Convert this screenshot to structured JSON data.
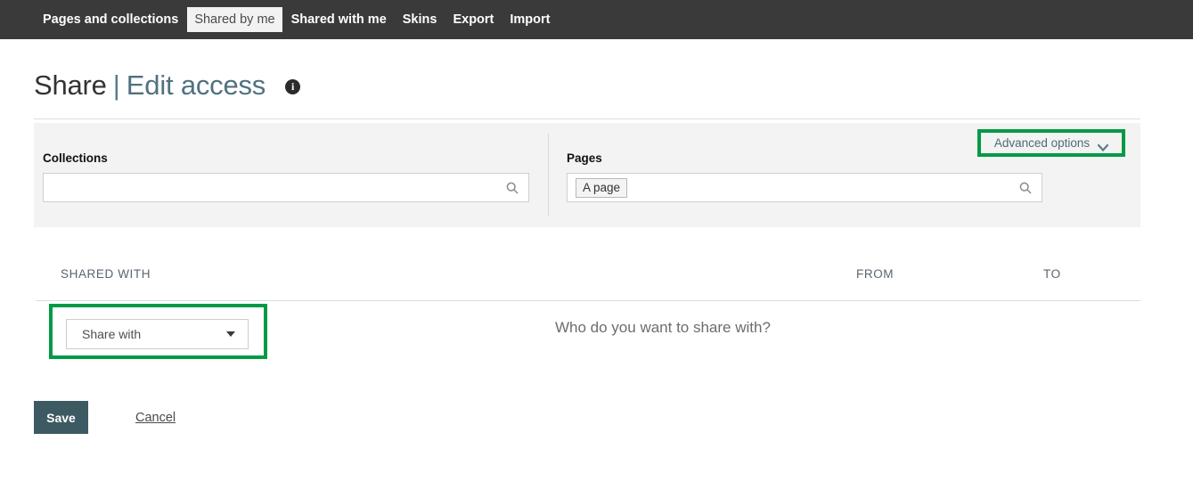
{
  "topnav": {
    "items": [
      {
        "label": "Pages and collections",
        "active": false
      },
      {
        "label": "Shared by me",
        "active": true
      },
      {
        "label": "Shared with me",
        "active": false
      },
      {
        "label": "Skins",
        "active": false
      },
      {
        "label": "Export",
        "active": false
      },
      {
        "label": "Import",
        "active": false
      }
    ]
  },
  "header": {
    "title_main": "Share",
    "title_separator": "|",
    "title_sub": "Edit access",
    "info_icon": "info-icon",
    "info_glyph": "i"
  },
  "search_panel": {
    "collections": {
      "label": "Collections",
      "value": "",
      "placeholder": "",
      "icon": "search-icon"
    },
    "pages": {
      "label": "Pages",
      "chips": [
        "A page"
      ],
      "value": "",
      "placeholder": "",
      "icon": "search-icon"
    }
  },
  "advanced_options": {
    "label": "Advanced options",
    "icon": "chevron-down-icon",
    "highlighted": true
  },
  "table": {
    "columns": [
      "SHARED WITH",
      "FROM",
      "TO"
    ],
    "rows": []
  },
  "share_with": {
    "selected": "Share with",
    "options": [
      "Share with"
    ],
    "icon": "caret-down-icon",
    "highlighted": true,
    "prompt": "Who do you want to share with?"
  },
  "footer": {
    "save_label": "Save",
    "cancel_label": "Cancel"
  },
  "colors": {
    "nav_bg": "#3a3a3a",
    "panel_bg": "#f3f3f3",
    "annotation_green": "#019a45",
    "save_button": "#3d5a63",
    "title_accent": "#517180",
    "link": "#4c6c78"
  }
}
